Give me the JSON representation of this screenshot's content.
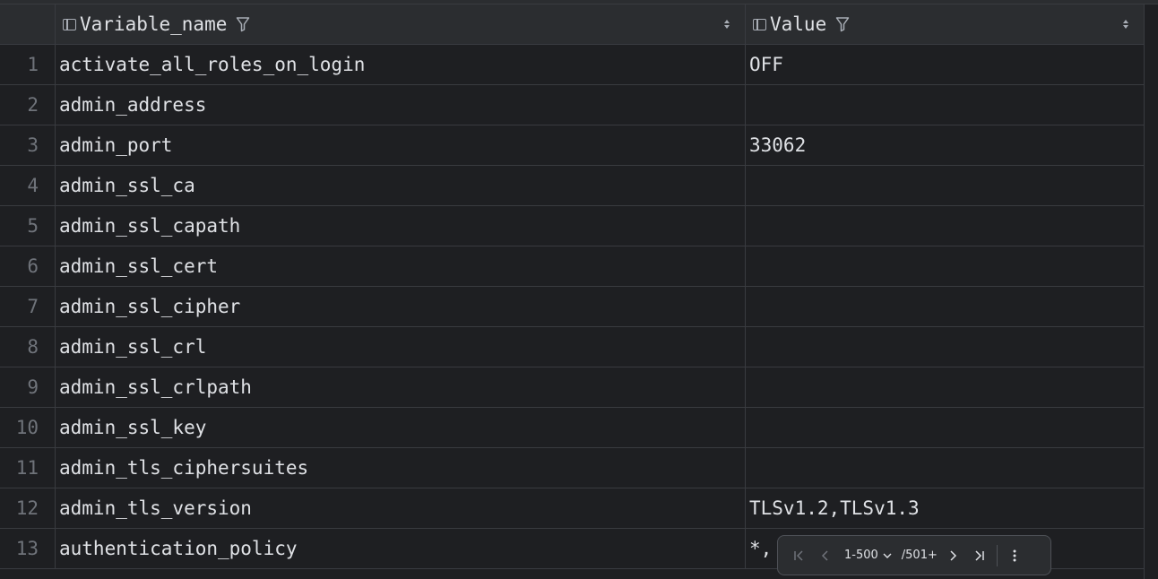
{
  "columns": [
    {
      "label": "Variable_name"
    },
    {
      "label": "Value"
    }
  ],
  "rows": [
    {
      "num": "1",
      "name": "activate_all_roles_on_login",
      "value": "OFF"
    },
    {
      "num": "2",
      "name": "admin_address",
      "value": ""
    },
    {
      "num": "3",
      "name": "admin_port",
      "value": "33062"
    },
    {
      "num": "4",
      "name": "admin_ssl_ca",
      "value": ""
    },
    {
      "num": "5",
      "name": "admin_ssl_capath",
      "value": ""
    },
    {
      "num": "6",
      "name": "admin_ssl_cert",
      "value": ""
    },
    {
      "num": "7",
      "name": "admin_ssl_cipher",
      "value": ""
    },
    {
      "num": "8",
      "name": "admin_ssl_crl",
      "value": ""
    },
    {
      "num": "9",
      "name": "admin_ssl_crlpath",
      "value": ""
    },
    {
      "num": "10",
      "name": "admin_ssl_key",
      "value": ""
    },
    {
      "num": "11",
      "name": "admin_tls_ciphersuites",
      "value": ""
    },
    {
      "num": "12",
      "name": "admin_tls_version",
      "value": "TLSv1.2,TLSv1.3"
    },
    {
      "num": "13",
      "name": "authentication_policy",
      "value": "*,"
    }
  ],
  "pager": {
    "range": "1-500",
    "total": "/501+"
  },
  "icons": {
    "column": "column-icon",
    "filter": "filter-icon",
    "sort": "sort-icon",
    "first_page": "first-page-icon",
    "prev_page": "prev-page-icon",
    "next_page": "next-page-icon",
    "last_page": "last-page-icon",
    "more": "more-vertical-icon"
  },
  "colors": {
    "background": "#1e1f22",
    "header": "#2b2d30",
    "text": "#dfe1e5",
    "row_number": "#6f737a",
    "grid_line": "#393b40"
  }
}
